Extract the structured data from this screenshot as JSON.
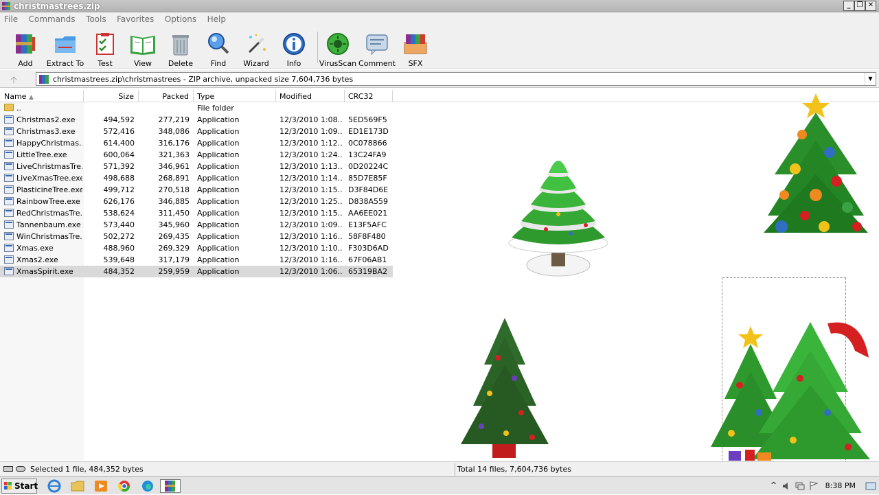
{
  "window": {
    "title": "christmastrees.zip",
    "min_label": "_",
    "max_label": "❐",
    "close_label": "✕"
  },
  "menu": [
    "File",
    "Commands",
    "Tools",
    "Favorites",
    "Options",
    "Help"
  ],
  "toolbar": {
    "add": "Add",
    "extract": "Extract To",
    "test": "Test",
    "view": "View",
    "delete": "Delete",
    "find": "Find",
    "wizard": "Wizard",
    "info": "Info",
    "virusscan": "VirusScan",
    "comment": "Comment",
    "sfx": "SFX"
  },
  "address": {
    "up_label": "🡡",
    "path": "christmastrees.zip\\christmastrees - ZIP archive, unpacked size 7,604,736 bytes",
    "dropdown": "▼"
  },
  "columns": {
    "name": "Name",
    "size": "Size",
    "packed": "Packed",
    "type": "Type",
    "modified": "Modified",
    "crc": "CRC32"
  },
  "files": [
    {
      "name": "..",
      "size": "",
      "packed": "",
      "type": "File folder",
      "modified": "",
      "crc": "",
      "folder": true
    },
    {
      "name": "Christmas2.exe",
      "size": "494,592",
      "packed": "277,219",
      "type": "Application",
      "modified": "12/3/2010 1:08...",
      "crc": "5ED569F5"
    },
    {
      "name": "Christmas3.exe",
      "size": "572,416",
      "packed": "348,086",
      "type": "Application",
      "modified": "12/3/2010 1:09...",
      "crc": "ED1E173D"
    },
    {
      "name": "HappyChristmas....",
      "size": "614,400",
      "packed": "316,176",
      "type": "Application",
      "modified": "12/3/2010 1:12...",
      "crc": "0C078866"
    },
    {
      "name": "LittleTree.exe",
      "size": "600,064",
      "packed": "321,363",
      "type": "Application",
      "modified": "12/3/2010 1:24...",
      "crc": "13C24FA9"
    },
    {
      "name": "LiveChristmasTre...",
      "size": "571,392",
      "packed": "346,961",
      "type": "Application",
      "modified": "12/3/2010 1:13...",
      "crc": "0D20224C"
    },
    {
      "name": "LiveXmasTree.exe",
      "size": "498,688",
      "packed": "268,891",
      "type": "Application",
      "modified": "12/3/2010 1:14...",
      "crc": "85D7E85F"
    },
    {
      "name": "PlasticineTree.exe",
      "size": "499,712",
      "packed": "270,518",
      "type": "Application",
      "modified": "12/3/2010 1:15...",
      "crc": "D3F84D6E"
    },
    {
      "name": "RainbowTree.exe",
      "size": "626,176",
      "packed": "346,885",
      "type": "Application",
      "modified": "12/3/2010 1:25...",
      "crc": "D838A559"
    },
    {
      "name": "RedChristmasTre...",
      "size": "538,624",
      "packed": "311,450",
      "type": "Application",
      "modified": "12/3/2010 1:15...",
      "crc": "AA6EE021"
    },
    {
      "name": "Tannenbaum.exe",
      "size": "573,440",
      "packed": "345,960",
      "type": "Application",
      "modified": "12/3/2010 1:09...",
      "crc": "E13F5AFC"
    },
    {
      "name": "WinChristmasTre...",
      "size": "502,272",
      "packed": "269,435",
      "type": "Application",
      "modified": "12/3/2010 1:16...",
      "crc": "58F8F480"
    },
    {
      "name": "Xmas.exe",
      "size": "488,960",
      "packed": "269,329",
      "type": "Application",
      "modified": "12/3/2010 1:10...",
      "crc": "F303D6AD"
    },
    {
      "name": "Xmas2.exe",
      "size": "539,648",
      "packed": "317,179",
      "type": "Application",
      "modified": "12/3/2010 1:16...",
      "crc": "67F06AB1"
    },
    {
      "name": "XmasSpirit.exe",
      "size": "484,352",
      "packed": "259,959",
      "type": "Application",
      "modified": "12/3/2010 1:06...",
      "crc": "65319BA2",
      "selected": true
    }
  ],
  "status": {
    "left": "Selected 1 file, 484,352 bytes",
    "right": "Total 14 files, 7,604,736 bytes"
  },
  "taskbar": {
    "start": "Start",
    "clock": "8:38 PM"
  },
  "colors": {
    "tree_green": "#1f8a2a",
    "ornament_red": "#d42020",
    "gold": "#f2c21a"
  }
}
